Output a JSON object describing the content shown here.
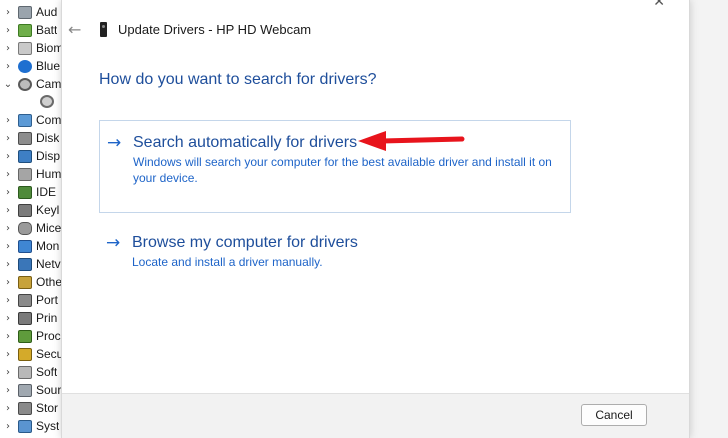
{
  "tree": {
    "items": [
      {
        "chevron": ">",
        "label": "Aud",
        "icon": "audio-icon"
      },
      {
        "chevron": ">",
        "label": "Batt",
        "icon": "battery-icon"
      },
      {
        "chevron": ">",
        "label": "Biom",
        "icon": "biometric-icon"
      },
      {
        "chevron": ">",
        "label": "Blue",
        "icon": "bluetooth-icon"
      },
      {
        "chevron": "v",
        "label": "Cam",
        "icon": "camera-icon"
      },
      {
        "chevron": "",
        "label": "",
        "icon": "webcam-icon",
        "child": true
      },
      {
        "chevron": ">",
        "label": "Com",
        "icon": "computer-icon"
      },
      {
        "chevron": ">",
        "label": "Disk",
        "icon": "disk-icon"
      },
      {
        "chevron": ">",
        "label": "Disp",
        "icon": "display-icon"
      },
      {
        "chevron": ">",
        "label": "Hum",
        "icon": "hid-icon"
      },
      {
        "chevron": ">",
        "label": "IDE",
        "icon": "ide-icon"
      },
      {
        "chevron": ">",
        "label": "Keyl",
        "icon": "keyboard-icon"
      },
      {
        "chevron": ">",
        "label": "Mice",
        "icon": "mouse-icon"
      },
      {
        "chevron": ">",
        "label": "Mon",
        "icon": "monitor-icon"
      },
      {
        "chevron": ">",
        "label": "Netv",
        "icon": "network-icon"
      },
      {
        "chevron": ">",
        "label": "Othe",
        "icon": "other-devices-icon"
      },
      {
        "chevron": ">",
        "label": "Port",
        "icon": "ports-icon"
      },
      {
        "chevron": ">",
        "label": "Prin",
        "icon": "printer-icon"
      },
      {
        "chevron": ">",
        "label": "Proc",
        "icon": "processor-icon"
      },
      {
        "chevron": ">",
        "label": "Secu",
        "icon": "security-icon"
      },
      {
        "chevron": ">",
        "label": "Soft",
        "icon": "software-icon"
      },
      {
        "chevron": ">",
        "label": "Sour",
        "icon": "sound-icon"
      },
      {
        "chevron": ">",
        "label": "Stor",
        "icon": "storage-icon"
      },
      {
        "chevron": ">",
        "label": "Syst",
        "icon": "system-icon"
      }
    ]
  },
  "dialog": {
    "close_glyph": "✕",
    "back_glyph": "←",
    "title": "Update Drivers - HP HD Webcam",
    "question": "How do you want to search for drivers?",
    "options": [
      {
        "arrow": "→",
        "title": "Search automatically for drivers",
        "description": "Windows will search your computer for the best available driver and install it on your device."
      },
      {
        "arrow": "→",
        "title": "Browse my computer for drivers",
        "description": "Locate and install a driver manually."
      }
    ],
    "cancel_label": "Cancel"
  },
  "colors": {
    "link_blue": "#1e4e9b",
    "desc_blue": "#1e64c8",
    "annotation_red": "#e8141c"
  }
}
